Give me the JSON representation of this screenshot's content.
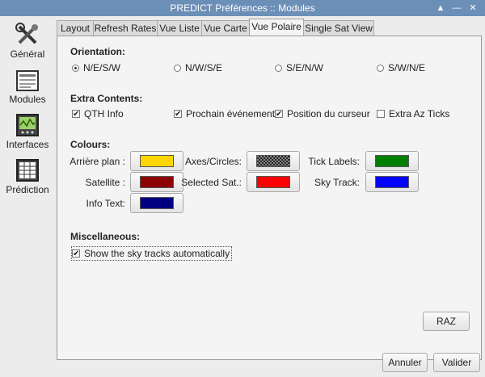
{
  "window": {
    "title": "PREDICT Préférences :: Modules",
    "controls": [
      "chevron-up-icon",
      "minimize-icon",
      "close-icon"
    ]
  },
  "sidebar": {
    "items": [
      {
        "label": "Général",
        "icon": "tools-icon"
      },
      {
        "label": "Modules",
        "icon": "modules-icon"
      },
      {
        "label": "Interfaces",
        "icon": "interfaces-icon"
      },
      {
        "label": "Prédiction",
        "icon": "prediction-icon"
      }
    ]
  },
  "tabs": [
    {
      "label": "Layout"
    },
    {
      "label": "Refresh Rates"
    },
    {
      "label": "Vue Liste"
    },
    {
      "label": "Vue Carte"
    },
    {
      "label": "Vue Polaire",
      "active": true
    },
    {
      "label": "Single Sat View"
    }
  ],
  "orientation": {
    "title": "Orientation:",
    "options": [
      {
        "label": "N/E/S/W",
        "selected": true
      },
      {
        "label": "N/W/S/E",
        "selected": false
      },
      {
        "label": "S/E/N/W",
        "selected": false
      },
      {
        "label": "S/W/N/E",
        "selected": false
      }
    ]
  },
  "extra": {
    "title": "Extra Contents:",
    "options": [
      {
        "label": "QTH Info",
        "checked": true
      },
      {
        "label": "Prochain événement",
        "checked": true
      },
      {
        "label": "Position du curseur",
        "checked": true
      },
      {
        "label": "Extra Az Ticks",
        "checked": false
      }
    ]
  },
  "colours": {
    "title": "Colours:",
    "items": [
      {
        "label": "Arrière plan :",
        "color": "#ffd700"
      },
      {
        "label": "Axes/Circles:",
        "color": "#404040",
        "pattern": "checker"
      },
      {
        "label": "Tick Labels:",
        "color": "#007f00"
      },
      {
        "label": "Satellite :",
        "color": "#8b0000"
      },
      {
        "label": "Selected Sat.:",
        "color": "#ff0000"
      },
      {
        "label": "Sky Track:",
        "color": "#0000ff"
      },
      {
        "label": "Info Text:",
        "color": "#000080"
      }
    ]
  },
  "misc": {
    "title": "Miscellaneous:",
    "sky_tracks_label": "Show the sky tracks automatically",
    "sky_tracks_checked": true
  },
  "buttons": {
    "reset": "RAZ",
    "cancel": "Annuler",
    "ok": "Valider"
  }
}
